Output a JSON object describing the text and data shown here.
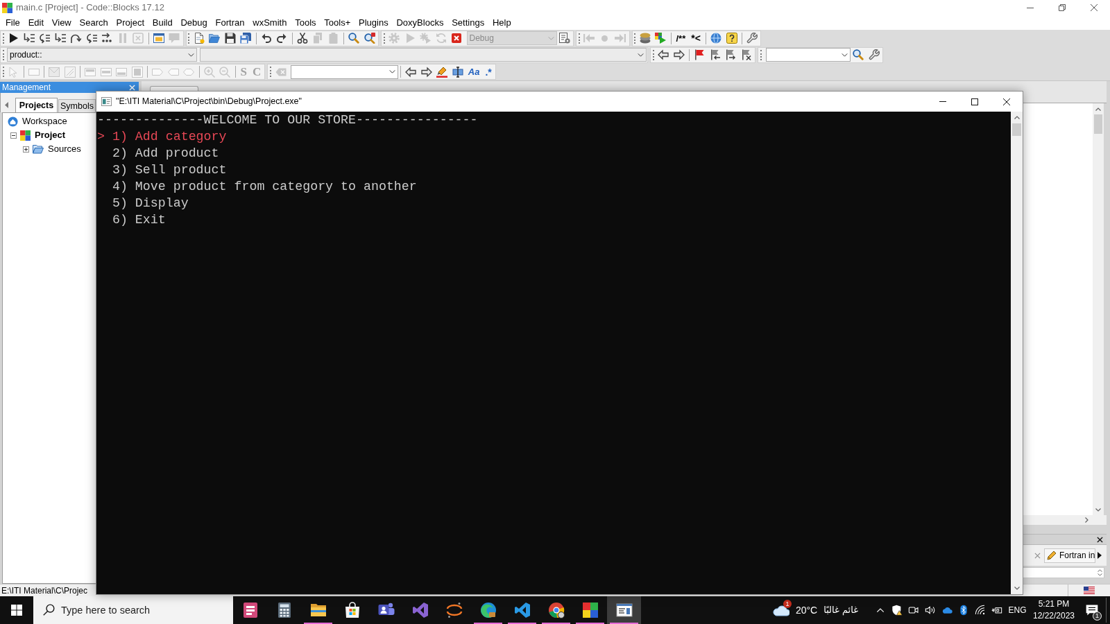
{
  "window": {
    "title": "main.c [Project] - Code::Blocks 17.12"
  },
  "menu": [
    "File",
    "Edit",
    "View",
    "Search",
    "Project",
    "Build",
    "Debug",
    "Fortran",
    "wxSmith",
    "Tools",
    "Tools+",
    "Plugins",
    "DoxyBlocks",
    "Settings",
    "Help"
  ],
  "toolbar_rows": [
    {
      "toolbars": [
        {
          "sections": [
            [
              {
                "kind": "icon",
                "disabled": false
              },
              {
                "kind": "icon",
                "disabled": false
              },
              {
                "kind": "icon",
                "disabled": false
              },
              {
                "kind": "icon",
                "disabled": false
              },
              {
                "kind": "icon",
                "disabled": false
              },
              {
                "kind": "icon",
                "disabled": false
              },
              {
                "kind": "icon",
                "disabled": false
              },
              {
                "kind": "icon",
                "disabled": true
              },
              {
                "kind": "icon",
                "disabled": true
              }
            ],
            [
              {
                "kind": "icon",
                "disabled": false
              },
              {
                "kind": "icon",
                "disabled": true
              }
            ]
          ]
        },
        {
          "sections": [
            [
              {
                "kind": "icon",
                "disabled": false
              },
              {
                "kind": "icon",
                "disabled": false
              },
              {
                "kind": "icon",
                "disabled": false
              },
              {
                "kind": "icon",
                "disabled": false
              }
            ],
            [
              {
                "kind": "icon",
                "disabled": false
              },
              {
                "kind": "icon",
                "disabled": false
              }
            ],
            [
              {
                "kind": "icon",
                "disabled": false
              },
              {
                "kind": "icon",
                "disabled": true
              },
              {
                "kind": "icon",
                "disabled": true
              }
            ],
            [
              {
                "kind": "icon",
                "disabled": false
              },
              {
                "kind": "icon",
                "disabled": false
              }
            ]
          ]
        },
        {
          "sections": [
            [
              {
                "kind": "icon",
                "disabled": true
              },
              {
                "kind": "icon",
                "disabled": true
              },
              {
                "kind": "icon",
                "disabled": true
              },
              {
                "kind": "icon",
                "disabled": true
              },
              {
                "kind": "icon",
                "disabled": false
              },
              {
                "kind": "dropdown",
                "value": "Debug",
                "disabled": true
              },
              {
                "kind": "icon",
                "disabled": false
              }
            ]
          ]
        },
        {
          "sections": [
            [
              {
                "kind": "icon",
                "disabled": true
              },
              {
                "kind": "icon",
                "disabled": true
              },
              {
                "kind": "icon",
                "disabled": true
              }
            ]
          ]
        },
        {
          "sections": [
            [
              {
                "kind": "icon",
                "disabled": false
              },
              {
                "kind": "icon",
                "disabled": false
              }
            ],
            [
              {
                "kind": "label",
                "label": "/**",
                "disabled": false
              },
              {
                "kind": "label",
                "label": "*<",
                "disabled": false
              }
            ],
            [
              {
                "kind": "icon",
                "disabled": false
              },
              {
                "kind": "icon",
                "disabled": false
              }
            ],
            [
              {
                "kind": "icon",
                "disabled": false
              }
            ]
          ]
        }
      ]
    },
    {
      "toolbars": [
        {
          "sections": [
            [
              {
                "kind": "dropdown",
                "value": "product::",
                "disabled": false
              },
              {
                "kind": "dropdown",
                "disabled": false
              }
            ]
          ]
        },
        {
          "sections": [
            [
              {
                "kind": "icon",
                "disabled": false
              },
              {
                "kind": "icon",
                "disabled": false
              }
            ],
            [
              {
                "kind": "icon",
                "disabled": false
              },
              {
                "kind": "icon",
                "disabled": false
              },
              {
                "kind": "icon",
                "disabled": false
              },
              {
                "kind": "icon",
                "disabled": false
              }
            ]
          ]
        },
        {
          "sections": [
            [
              {
                "kind": "combo",
                "disabled": false
              },
              {
                "kind": "icon",
                "disabled": false
              },
              {
                "kind": "icon",
                "disabled": false
              }
            ]
          ]
        }
      ]
    },
    {
      "toolbars": [
        {
          "sections": [
            [
              {
                "kind": "icon",
                "disabled": true
              }
            ],
            [
              {
                "kind": "icon",
                "disabled": true
              }
            ],
            [
              {
                "kind": "icon",
                "disabled": true
              },
              {
                "kind": "icon",
                "disabled": true
              }
            ],
            [
              {
                "kind": "icon",
                "disabled": true
              },
              {
                "kind": "icon",
                "disabled": true
              },
              {
                "kind": "icon",
                "disabled": true
              },
              {
                "kind": "icon",
                "disabled": true
              }
            ],
            [
              {
                "kind": "icon",
                "disabled": true
              },
              {
                "kind": "icon",
                "disabled": true
              },
              {
                "kind": "icon",
                "disabled": true
              }
            ],
            [
              {
                "kind": "icon",
                "disabled": true
              },
              {
                "kind": "icon",
                "disabled": true
              }
            ],
            [
              {
                "kind": "label",
                "label": "S",
                "disabled": true
              },
              {
                "kind": "label",
                "label": "C",
                "disabled": true
              }
            ]
          ]
        },
        {
          "sections": [
            [
              {
                "kind": "icon",
                "disabled": true
              },
              {
                "kind": "combo",
                "disabled": false
              }
            ],
            [
              {
                "kind": "icon",
                "disabled": false
              },
              {
                "kind": "icon",
                "disabled": false
              },
              {
                "kind": "icon",
                "disabled": false
              },
              {
                "kind": "icon",
                "disabled": false
              },
              {
                "kind": "label",
                "label": "Aa",
                "disabled": false
              },
              {
                "kind": "label",
                "label": ".*",
                "disabled": false
              }
            ]
          ]
        }
      ]
    }
  ],
  "management": {
    "title": "Management",
    "tabs": [
      {
        "label": "Projects",
        "selected": true
      },
      {
        "label": "Symbols",
        "selected": false
      }
    ],
    "tree": [
      {
        "kind": "workspace",
        "label": "Workspace",
        "active": false,
        "children": [
          {
            "kind": "project",
            "label": "Project",
            "active": true,
            "expanded": true,
            "children": [
              {
                "kind": "folder",
                "label": "Sources",
                "active": false,
                "expanded": false
              }
            ]
          }
        ]
      }
    ]
  },
  "logs": {
    "tabs": [
      {
        "label": "Fortran in",
        "selected": false
      }
    ]
  },
  "status_bar": {
    "text": "E:\\ITI Material\\C\\Projec"
  },
  "console": {
    "title": "\"E:\\ITI Material\\C\\Project\\bin\\Debug\\Project.exe\"",
    "header": "--------------WELCOME TO OUR STORE----------------",
    "cursor": ">",
    "options": [
      {
        "label": "1) Add category",
        "selected": true
      },
      {
        "label": "2) Add product",
        "selected": false
      },
      {
        "label": "3) Sell product",
        "selected": false
      },
      {
        "label": "4) Move product from category to another",
        "selected": false
      },
      {
        "label": "5) Display",
        "selected": false
      },
      {
        "label": "6) Exit",
        "selected": false
      }
    ]
  },
  "taskbar": {
    "search": {
      "placeholder": "Type here to search"
    },
    "apps": [
      {
        "running": false,
        "active": false
      },
      {
        "running": false,
        "active": false
      },
      {
        "running": true,
        "active": false
      },
      {
        "running": false,
        "active": false
      },
      {
        "running": false,
        "active": false
      },
      {
        "running": false,
        "active": false
      },
      {
        "running": false,
        "active": false
      },
      {
        "running": true,
        "active": false
      },
      {
        "running": true,
        "active": false
      },
      {
        "running": true,
        "active": false
      },
      {
        "running": true,
        "active": false
      },
      {
        "running": true,
        "active": true
      }
    ],
    "weather": {
      "badge": "1",
      "temperature": "20°C",
      "condition": "غائم غالبًا"
    },
    "language": "ENG",
    "time": "5:21 PM",
    "date": "12/22/2023",
    "notifications": {
      "badge": "1"
    }
  }
}
